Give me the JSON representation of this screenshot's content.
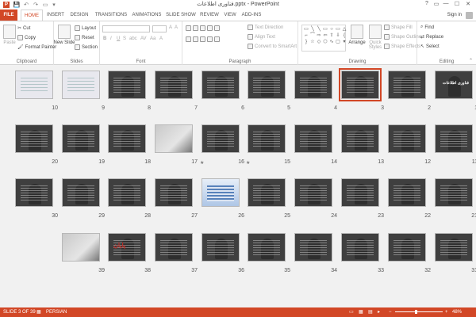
{
  "titlebar": {
    "title": "فناوری اطلاعات.pptx - PowerPoint",
    "qa_save": "💾",
    "qa_undo": "↶",
    "qa_redo": "↷",
    "qa_present": "▭",
    "qa_more": "▾",
    "help": "?",
    "restore": "▭",
    "minimize": "—",
    "maximize": "☐",
    "close": "✕"
  },
  "tabs": [
    "FILE",
    "HOME",
    "INSERT",
    "DESIGN",
    "TRANSITIONS",
    "ANIMATIONS",
    "SLIDE SHOW",
    "REVIEW",
    "VIEW",
    "ADD-INS"
  ],
  "signin": "Sign in",
  "ribbon": {
    "clipboard": {
      "paste": "Paste",
      "cut": "Cut",
      "copy": "Copy",
      "format_painter": "Format Painter",
      "label": "Clipboard"
    },
    "slides": {
      "new_slide": "New Slide",
      "layout": "Layout",
      "reset": "Reset",
      "section": "Section",
      "label": "Slides"
    },
    "font": {
      "label": "Font",
      "bold": "B",
      "italic": "I",
      "underline": "U",
      "strike": "S",
      "shadow": "abc",
      "spacing": "AV",
      "case": "Aa",
      "color": "A"
    },
    "paragraph": {
      "text_direction": "Text Direction",
      "align_text": "Align Text",
      "smartart": "Convert to SmartArt",
      "label": "Paragraph"
    },
    "drawing": {
      "arrange": "Arrange",
      "quick_styles": "Quick Styles",
      "shape_fill": "Shape Fill",
      "shape_outline": "Shape Outline",
      "shape_effects": "Shape Effects",
      "label": "Drawing"
    },
    "editing": {
      "find": "Find",
      "replace": "Replace",
      "select": "Select",
      "label": "Editing"
    }
  },
  "slides": [
    {
      "n": "1",
      "kind": "title",
      "title": "فناوری اطلاعات"
    },
    {
      "n": "2",
      "kind": "dark"
    },
    {
      "n": "3",
      "kind": "dark",
      "selected": true
    },
    {
      "n": "4",
      "kind": "dark"
    },
    {
      "n": "5",
      "kind": "dark"
    },
    {
      "n": "6",
      "kind": "dark"
    },
    {
      "n": "7",
      "kind": "dark"
    },
    {
      "n": "8",
      "kind": "dark"
    },
    {
      "n": "9",
      "kind": "light"
    },
    {
      "n": "10",
      "kind": "light"
    },
    {
      "n": "11",
      "kind": "dark"
    },
    {
      "n": "12",
      "kind": "dark"
    },
    {
      "n": "13",
      "kind": "dark"
    },
    {
      "n": "14",
      "kind": "dark"
    },
    {
      "n": "15",
      "kind": "dark",
      "star": true
    },
    {
      "n": "16",
      "kind": "dark",
      "star": true
    },
    {
      "n": "17",
      "kind": "photo"
    },
    {
      "n": "18",
      "kind": "dark"
    },
    {
      "n": "19",
      "kind": "dark"
    },
    {
      "n": "20",
      "kind": "dark"
    },
    {
      "n": "21",
      "kind": "dark"
    },
    {
      "n": "22",
      "kind": "dark"
    },
    {
      "n": "23",
      "kind": "dark"
    },
    {
      "n": "24",
      "kind": "dark"
    },
    {
      "n": "25",
      "kind": "dark"
    },
    {
      "n": "26",
      "kind": "blue"
    },
    {
      "n": "27",
      "kind": "dark"
    },
    {
      "n": "28",
      "kind": "dark"
    },
    {
      "n": "29",
      "kind": "dark"
    },
    {
      "n": "30",
      "kind": "dark"
    },
    {
      "n": "31",
      "kind": "dark"
    },
    {
      "n": "32",
      "kind": "dark"
    },
    {
      "n": "33",
      "kind": "dark"
    },
    {
      "n": "34",
      "kind": "dark"
    },
    {
      "n": "35",
      "kind": "dark"
    },
    {
      "n": "36",
      "kind": "dark"
    },
    {
      "n": "37",
      "kind": "dark"
    },
    {
      "n": "38",
      "kind": "redtitle",
      "title": "پایان"
    },
    {
      "n": "39",
      "kind": "photo"
    }
  ],
  "status": {
    "slide_info": "SLIDE 3 OF 39",
    "language": "PERSIAN",
    "zoom": "48%",
    "zoom_level": 0.48,
    "minus": "−",
    "plus": "+"
  },
  "colors": {
    "accent": "#d24726",
    "selection": "#d24726"
  }
}
